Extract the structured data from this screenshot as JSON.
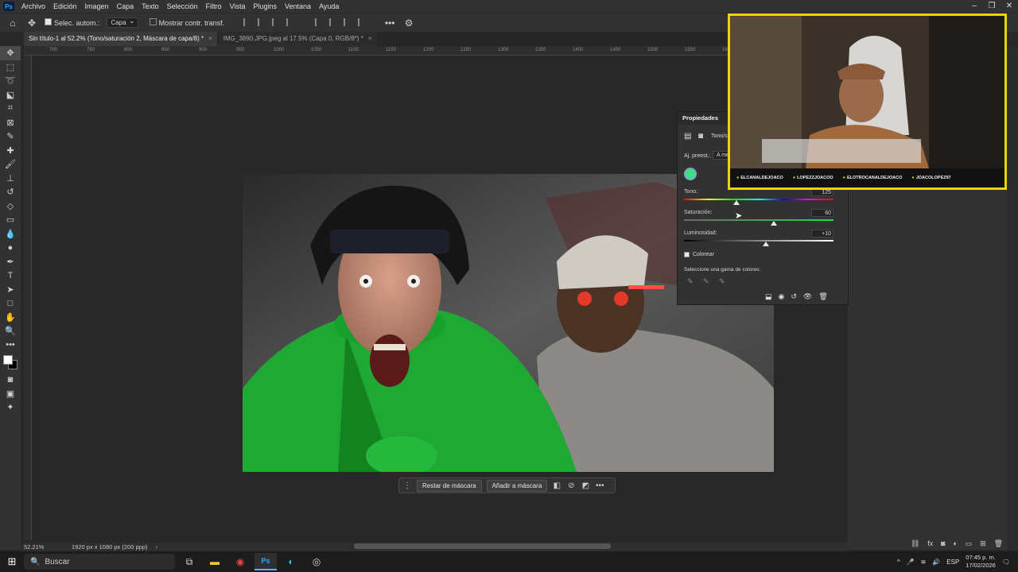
{
  "app": {
    "logo": "Ps"
  },
  "menu": [
    "Archivo",
    "Edición",
    "Imagen",
    "Capa",
    "Texto",
    "Selección",
    "Filtro",
    "Vista",
    "Plugins",
    "Ventana",
    "Ayuda"
  ],
  "options": {
    "auto_select_label": "Selec. autom.:",
    "auto_select_value": "Capa",
    "show_transform_label": "Mostrar contr. transf."
  },
  "tabs": [
    {
      "label": "Sin título-1 al 52.2% (Tono/saturación 2, Máscara de capa/8) *",
      "active": true
    },
    {
      "label": "IMG_3890.JPG.jpeg al 17.5% (Capa 0, RGB/8*) *",
      "active": false
    }
  ],
  "ruler_ticks": [
    "700",
    "750",
    "800",
    "850",
    "900",
    "950",
    "1000",
    "1050",
    "1100",
    "1150",
    "1200",
    "1250",
    "1300",
    "1350",
    "1400",
    "1450",
    "1500",
    "1550",
    "1600",
    "1650",
    "1700"
  ],
  "context_bar": {
    "btn1": "Restar de máscara",
    "btn2": "Añadir a máscara"
  },
  "status": {
    "zoom": "52.21%",
    "doc_info": "1920 px x 1080 px (200 ppp)"
  },
  "properties": {
    "title": "Propiedades",
    "adjustment_label": "Tono/s",
    "preset_label": "Aj. preest.:",
    "preset_value": "A me",
    "hue_label": "Tono:",
    "hue_value": "125",
    "hue_fraction": 0.35,
    "saturation_label": "Saturación:",
    "saturation_value": "60",
    "saturation_fraction": 0.6,
    "lightness_label": "Luminosidad:",
    "lightness_value": "+10",
    "lightness_fraction": 0.55,
    "colorize_label": "Colorear",
    "range_label": "Seleccione una gama de colores:"
  },
  "webcam": {
    "tags": [
      "ELCANALDEJOACO",
      "LOPEZZJOACOO",
      "ELOTROCANALDEJOACO",
      "JOACOLOPEZ97"
    ]
  },
  "taskbar": {
    "search_placeholder": "Buscar",
    "language": "ESP",
    "time": "07:45 p. m.",
    "date": "17/02/2026"
  },
  "colors": {
    "accent": "#31a8ff",
    "stream_frame": "#f0d400",
    "colorize_green": "#1fbf3a"
  }
}
